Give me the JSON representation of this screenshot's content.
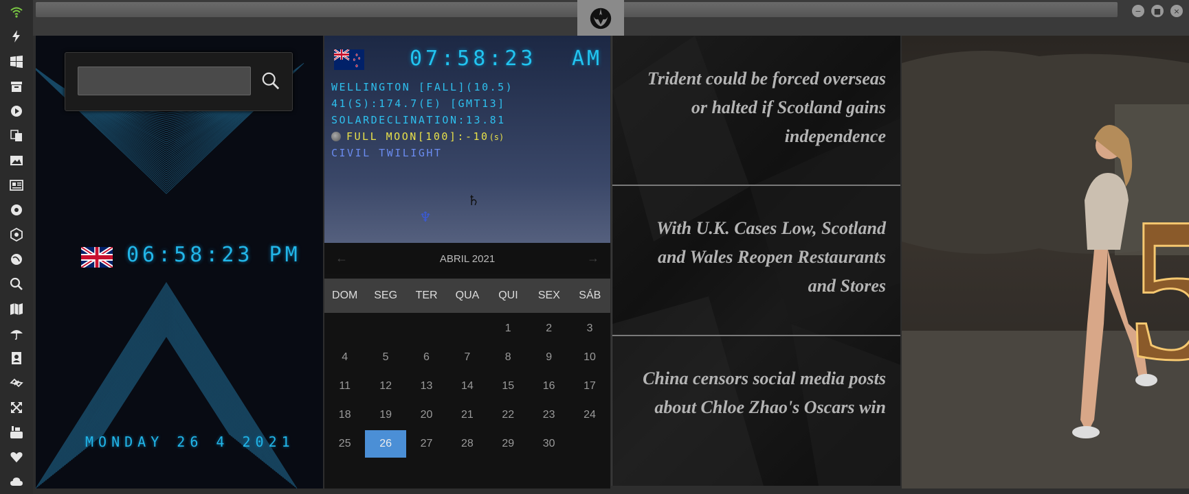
{
  "rail": {
    "icons": [
      "wifi-icon",
      "power-icon",
      "windows-icon",
      "archive-icon",
      "play-icon",
      "translate-icon",
      "image-icon",
      "news-icon",
      "settings-icon",
      "hexagon-icon",
      "globe-icon",
      "search-icon",
      "map-icon",
      "umbrella-icon",
      "contacts-icon",
      "link-icon",
      "expand-icon",
      "youtube-icon",
      "heart-icon",
      "cloud-icon"
    ],
    "wifi_color": "#7ac943"
  },
  "search": {
    "value": "",
    "placeholder": ""
  },
  "uk_clock": {
    "time": "06:58:23 PM",
    "date": "MONDAY 26 4 2021"
  },
  "nz_clock": {
    "time": "07:58:23",
    "ampm": "AM",
    "line1": "WELLINGTON [FALL](10.5)",
    "line2": "41(S):174.7(E) [GMT13]",
    "line3": "SOLARDECLINATION:13.81",
    "moon": "FULL MOON[100]:-10",
    "moon_suffix": "(s)",
    "twilight": "CIVIL TWILIGHT"
  },
  "planets": {
    "saturn": "♄",
    "neptune": "♆"
  },
  "calendar": {
    "month": "ABRIL 2021",
    "prev": "←",
    "next": "→",
    "weekdays": [
      "DOM",
      "SEG",
      "TER",
      "QUA",
      "QUI",
      "SEX",
      "SÁB"
    ],
    "leading_blanks": 4,
    "days": 30,
    "today": 26,
    "accent": "#4b8fd6"
  },
  "news": [
    {
      "headline": "Trident could be forced overseas or halted if Scotland gains independence"
    },
    {
      "headline": "With U.K. Cases Low, Scotland and Wales Reopen Restaurants and Stores"
    },
    {
      "headline": "China censors social media posts about Chloe Zhao's Oscars win"
    }
  ],
  "window_controls": {
    "minimize": "−",
    "maximize": "■",
    "close": "×"
  }
}
